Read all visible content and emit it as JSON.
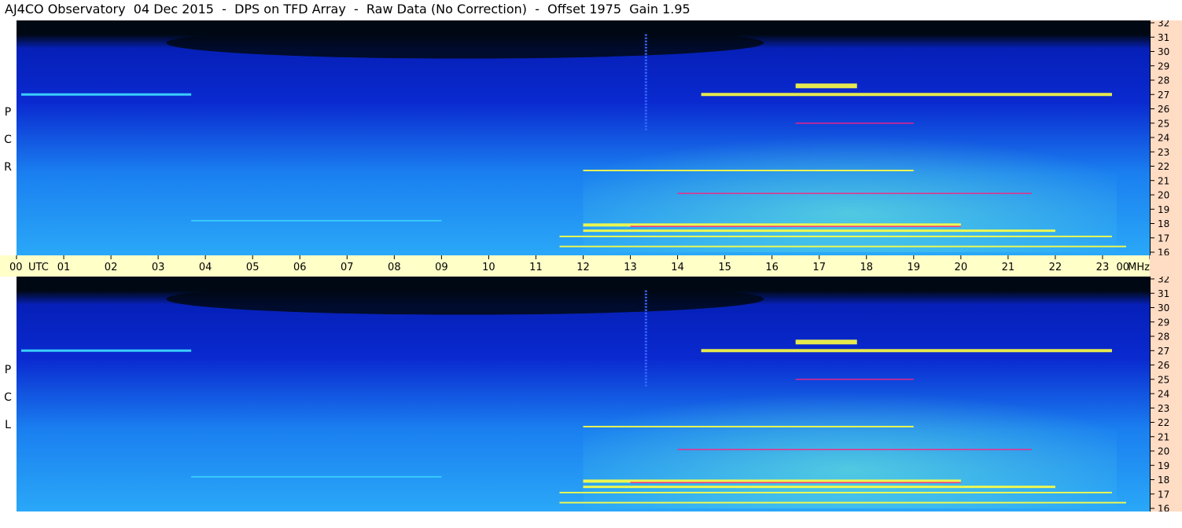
{
  "title": "AJ4CO Observatory  04 Dec 2015  -  DPS on TFD Array  -  Raw Data (No Correction)  -  Offset 1975  Gain 1.95",
  "panels": [
    {
      "label_letters": [
        "R",
        "C",
        "P"
      ]
    },
    {
      "label_letters": [
        "L",
        "C",
        "P"
      ]
    }
  ],
  "chart_data": {
    "type": "heatmap",
    "x_axis": {
      "ticks": [
        "00",
        "01",
        "02",
        "03",
        "04",
        "05",
        "06",
        "07",
        "08",
        "09",
        "10",
        "11",
        "12",
        "13",
        "14",
        "15",
        "16",
        "17",
        "18",
        "19",
        "20",
        "21",
        "22",
        "23",
        "00"
      ],
      "start_unit_label": "UTC",
      "range": [
        0,
        24
      ]
    },
    "y_axis": {
      "ticks": [
        "16",
        "17",
        "18",
        "19",
        "20",
        "21",
        "22",
        "23",
        "24",
        "25",
        "26",
        "27",
        "28",
        "29",
        "30",
        "31",
        "32"
      ],
      "unit_label": "MHz",
      "range": [
        16,
        32
      ]
    },
    "colors": {
      "background_low": "#000814",
      "low": "#0a2ad0",
      "mid": "#1a7ff0",
      "high": "#3fe0ff",
      "hot": "#ffff40",
      "peak": "#ff2080",
      "time_axis_bg": "#ffffc8",
      "freq_axis_bg": "#ffdcc4"
    }
  }
}
